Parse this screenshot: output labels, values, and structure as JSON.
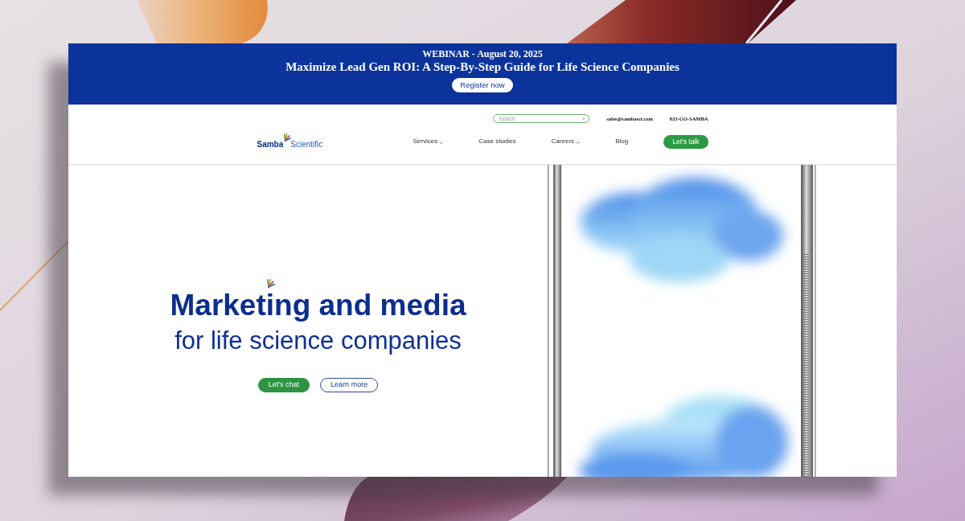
{
  "banner": {
    "eyebrow": "WEBINAR - August 20, 2025",
    "title": "Maximize Lead Gen ROI: A Step-By-Step Guide for Life Science Companies",
    "button": "Register now"
  },
  "header": {
    "search": {
      "placeholder": "Search",
      "submit": ">"
    },
    "email": "sales@sambasci.com",
    "phone": "833-GO-SAMBA",
    "logo": {
      "name": "Samba",
      "suffix": "Scientific"
    },
    "nav": [
      {
        "label": "Services",
        "dropdown": true
      },
      {
        "label": "Case studies",
        "dropdown": false
      },
      {
        "label": "Careers",
        "dropdown": true
      },
      {
        "label": "Blog",
        "dropdown": false
      }
    ],
    "cta": "Let's talk"
  },
  "hero": {
    "heading": "Marketing and media",
    "subheading": "for life science companies",
    "buttons": [
      {
        "label": "Let's chat",
        "kind": "filled"
      },
      {
        "label": "Learn more",
        "kind": "outline"
      }
    ]
  }
}
